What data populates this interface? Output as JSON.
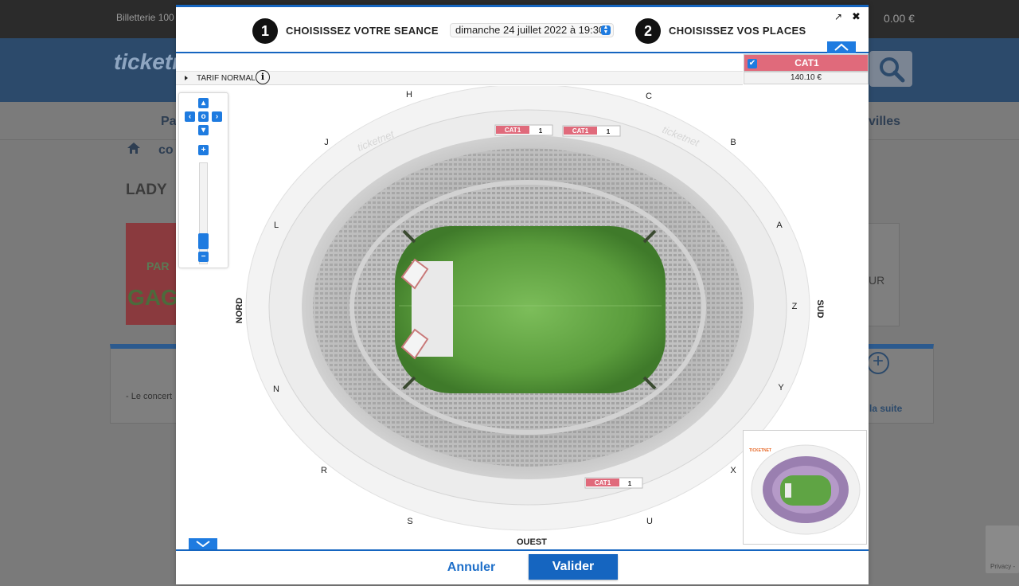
{
  "background": {
    "topbar_left": "Billetterie 100",
    "cart_total": "0.00 €",
    "logo": "ticketn",
    "nav_left": "Pa",
    "nav_right": "villes",
    "breadcrumb_text": "co",
    "title_partial": "LADY",
    "concert_note": "- Le concert",
    "read_more": "la suite",
    "side_text": "UR",
    "recaptcha": "Privacy -"
  },
  "modal": {
    "step1": {
      "number": "1",
      "label": "CHOISISSEZ VOTRE SEANCE"
    },
    "session_value": "dimanche 24 juillet 2022 à 19:30",
    "step2": {
      "number": "2",
      "label": "CHOISISSEZ VOS PLACES"
    },
    "popout_icon": "↗",
    "close_icon": "✖",
    "tarif": {
      "label": "TARIF NORMAL",
      "info": "i"
    },
    "category": {
      "name": "CAT1",
      "price": "140.10 €",
      "checked": true,
      "color": "#e06a7b"
    },
    "accent_color": "#1565c0"
  },
  "map": {
    "gate_labels": [
      "H",
      "C",
      "J",
      "B",
      "L",
      "A",
      "Z",
      "N",
      "Y",
      "R",
      "X",
      "S",
      "U"
    ],
    "side_labels": {
      "nord": "NORD",
      "sud": "SUD",
      "ouest": "OUEST"
    },
    "markers": [
      {
        "cat": "CAT1",
        "qty": "1"
      },
      {
        "cat": "CAT1",
        "qty": "1"
      },
      {
        "cat": "CAT1",
        "qty": "1"
      }
    ],
    "watermark": "ticketnet",
    "minimap_logo": "TICKETNET"
  },
  "footer": {
    "cancel": "Annuler",
    "validate": "Valider"
  }
}
